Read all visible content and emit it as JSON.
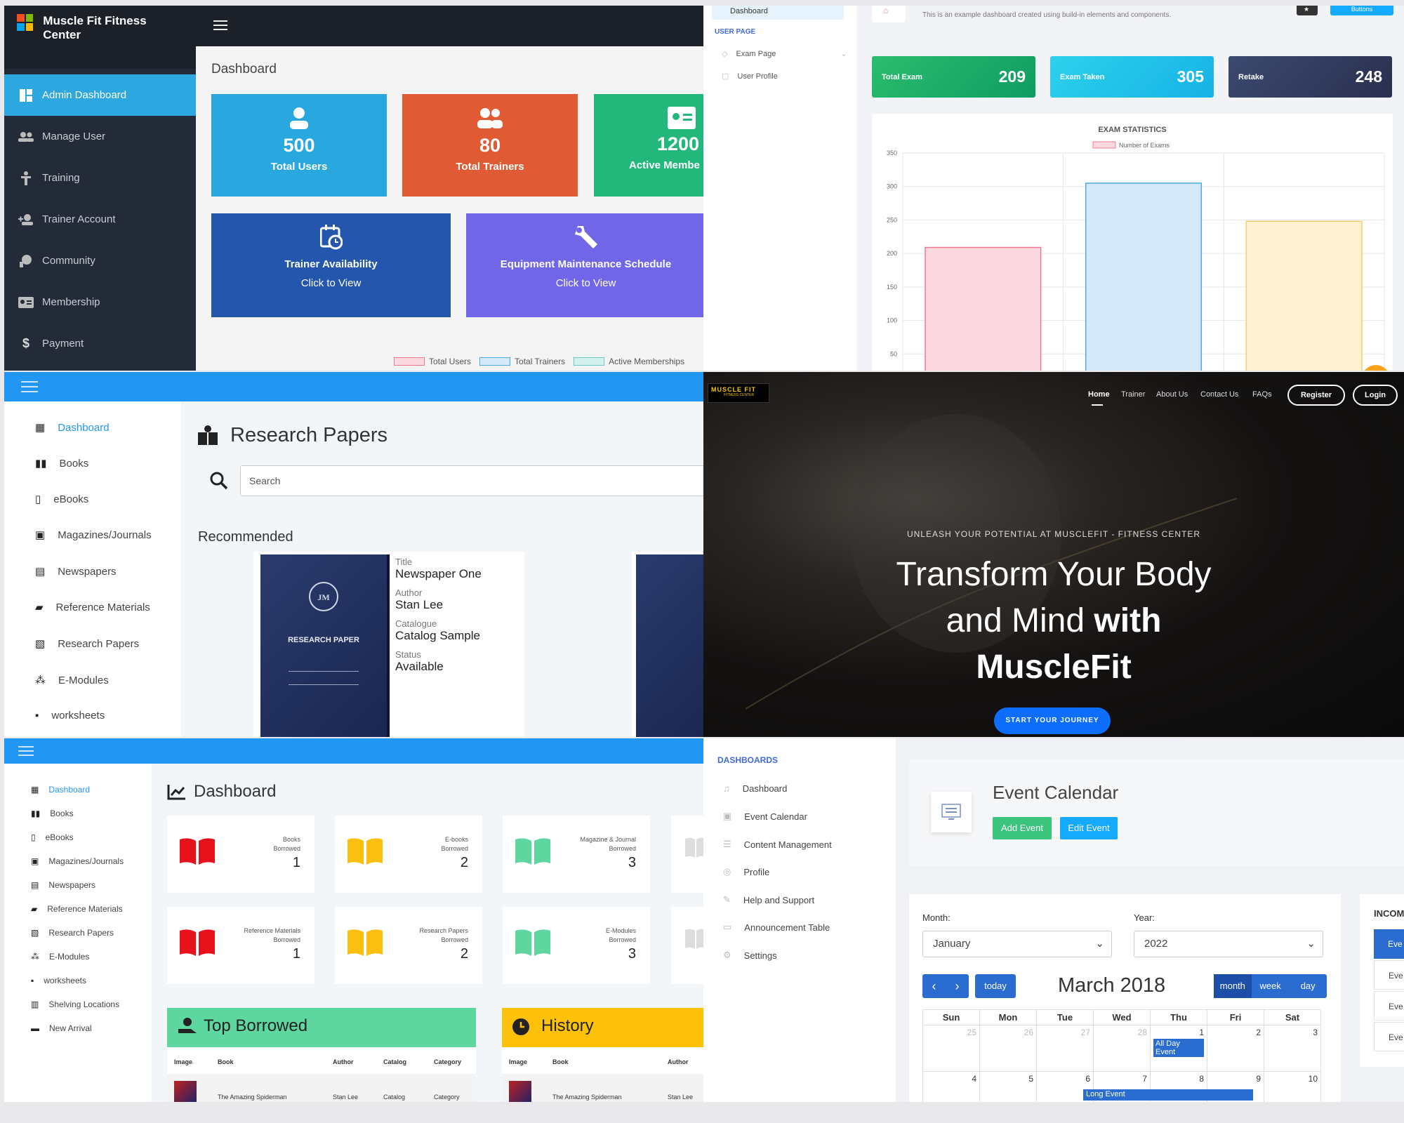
{
  "p1": {
    "brand": "Muscle Fit Fitness Center",
    "nav": [
      "Admin Dashboard",
      "Manage User",
      "Training",
      "Trainer Account",
      "Community",
      "Membership",
      "Payment"
    ],
    "title": "Dashboard",
    "stats": [
      {
        "value": "500",
        "label": "Total Users",
        "color": "#29a8e0"
      },
      {
        "value": "80",
        "label": "Total Trainers",
        "color": "#e05a33"
      },
      {
        "value": "1200",
        "label": "Active Membe",
        "color": "#23b77b"
      }
    ],
    "links": [
      {
        "label": "Trainer Availability",
        "sub": "Click to View",
        "color": "#2356ac"
      },
      {
        "label": "Equipment Maintenance Schedule",
        "sub": "Click to View",
        "color": "#7266e8"
      }
    ],
    "legend": [
      "Total Users",
      "Total Trainers",
      "Active Memberships"
    ]
  },
  "p2": {
    "side_items": [
      "Dashboard",
      "USER PAGE",
      "Exam Page",
      "User Profile"
    ],
    "subtitle": "This is an example dashboard created using build-in elements and components.",
    "buttons_label": "Buttons",
    "cards": [
      {
        "label": "Total Exam",
        "value": "209"
      },
      {
        "label": "Exam Taken",
        "value": "305"
      },
      {
        "label": "Retake",
        "value": "248"
      }
    ],
    "chart_title": "EXAM STATISTICS",
    "chart_data": {
      "type": "bar",
      "title": "EXAM STATISTICS",
      "series": [
        {
          "name": "Number of Exams",
          "values": [
            209,
            305,
            248
          ]
        }
      ],
      "ylim": [
        0,
        350
      ],
      "yticks": [
        "350",
        "300",
        "250",
        "200",
        "150",
        "100",
        "50"
      ],
      "colors": [
        "#fcd9e1",
        "#d5e9f8",
        "#fff2d3"
      ],
      "borders": [
        "#f17a93",
        "#52a9e6",
        "#f7ce6a"
      ]
    }
  },
  "p3": {
    "nav": [
      "Dashboard",
      "Books",
      "eBooks",
      "Magazines/Journals",
      "Newspapers",
      "Reference Materials",
      "Research Papers",
      "E-Modules",
      "worksheets"
    ],
    "title": "Research Papers",
    "search_placeholder": "Search",
    "recommended": "Recommended",
    "book_cover": "RESEARCH PAPER",
    "fields": [
      {
        "k": "Title",
        "v": "Newspaper One"
      },
      {
        "k": "Author",
        "v": "Stan Lee"
      },
      {
        "k": "Catalogue",
        "v": "Catalog Sample"
      },
      {
        "k": "Status",
        "v": "Available"
      }
    ]
  },
  "p4": {
    "logo": "MUSCLE FIT",
    "logo_sub": "FITNESS CENTER",
    "nav": [
      "Home",
      "Trainer",
      "About Us",
      "Contact Us",
      "FAQs"
    ],
    "register": "Register",
    "login": "Login",
    "tagline": "UNLEASH YOUR POTENTIAL AT MUSCLEFIT - FITNESS CENTER",
    "h1a": "Transform Your Body",
    "h1b": "and Mind",
    "h1c": "with",
    "h1d": "MuscleFit",
    "cta": "START YOUR JOURNEY"
  },
  "p5": {
    "nav": [
      "Dashboard",
      "Books",
      "eBooks",
      "Magazines/Journals",
      "Newspapers",
      "Reference Materials",
      "Research Papers",
      "E-Modules",
      "worksheets",
      "Shelving Locations",
      "New Arrival"
    ],
    "title": "Dashboard",
    "cards": [
      {
        "t1": "Books",
        "t2": "Borrowed",
        "n": "1",
        "c": "#e7131c"
      },
      {
        "t1": "E-books",
        "t2": "Borrowed",
        "n": "2",
        "c": "#fbbf10"
      },
      {
        "t1": "Magazine & Journal",
        "t2": "Borrowed",
        "n": "3",
        "c": "#5fd6a0"
      },
      {
        "t1": "Reference Materials",
        "t2": "Borrowed",
        "n": "1",
        "c": "#e7131c"
      },
      {
        "t1": "Research Papers",
        "t2": "Borrowed",
        "n": "2",
        "c": "#fbbf10"
      },
      {
        "t1": "E-Modules",
        "t2": "Borrowed",
        "n": "3",
        "c": "#5fd6a0"
      }
    ],
    "top_borrowed": "Top Borrowed",
    "history": "History",
    "tb_cols": [
      "Image",
      "Book",
      "Author",
      "Catalog",
      "Category"
    ],
    "h_cols": [
      "Image",
      "Book",
      "Author"
    ],
    "row": {
      "book": "The Amazing Spiderman",
      "author": "Stan Lee",
      "catalog": "Catalog",
      "category": "Category"
    }
  },
  "p6": {
    "section": "DASHBOARDS",
    "nav": [
      "Dashboard",
      "Event Calendar",
      "Content Management",
      "Profile",
      "Help and Support",
      "Announcement Table",
      "Settings"
    ],
    "title": "Event Calendar",
    "add": "Add Event",
    "edit": "Edit Event",
    "month_label": "Month:",
    "year_label": "Year:",
    "month_value": "January",
    "year_value": "2022",
    "today": "today",
    "cal_title": "March 2018",
    "views": [
      "month",
      "week",
      "day"
    ],
    "days": [
      "Sun",
      "Mon",
      "Tue",
      "Wed",
      "Thu",
      "Fri",
      "Sat"
    ],
    "row1": [
      "25",
      "26",
      "27",
      "28",
      "1",
      "2",
      "3"
    ],
    "row2": [
      "4",
      "5",
      "6",
      "7",
      "8",
      "9",
      "10"
    ],
    "event1": "All Day Event",
    "event2": "Long Event",
    "income": "INCOM",
    "eve": [
      "Eve",
      "Eve",
      "Eve",
      "Eve"
    ]
  }
}
